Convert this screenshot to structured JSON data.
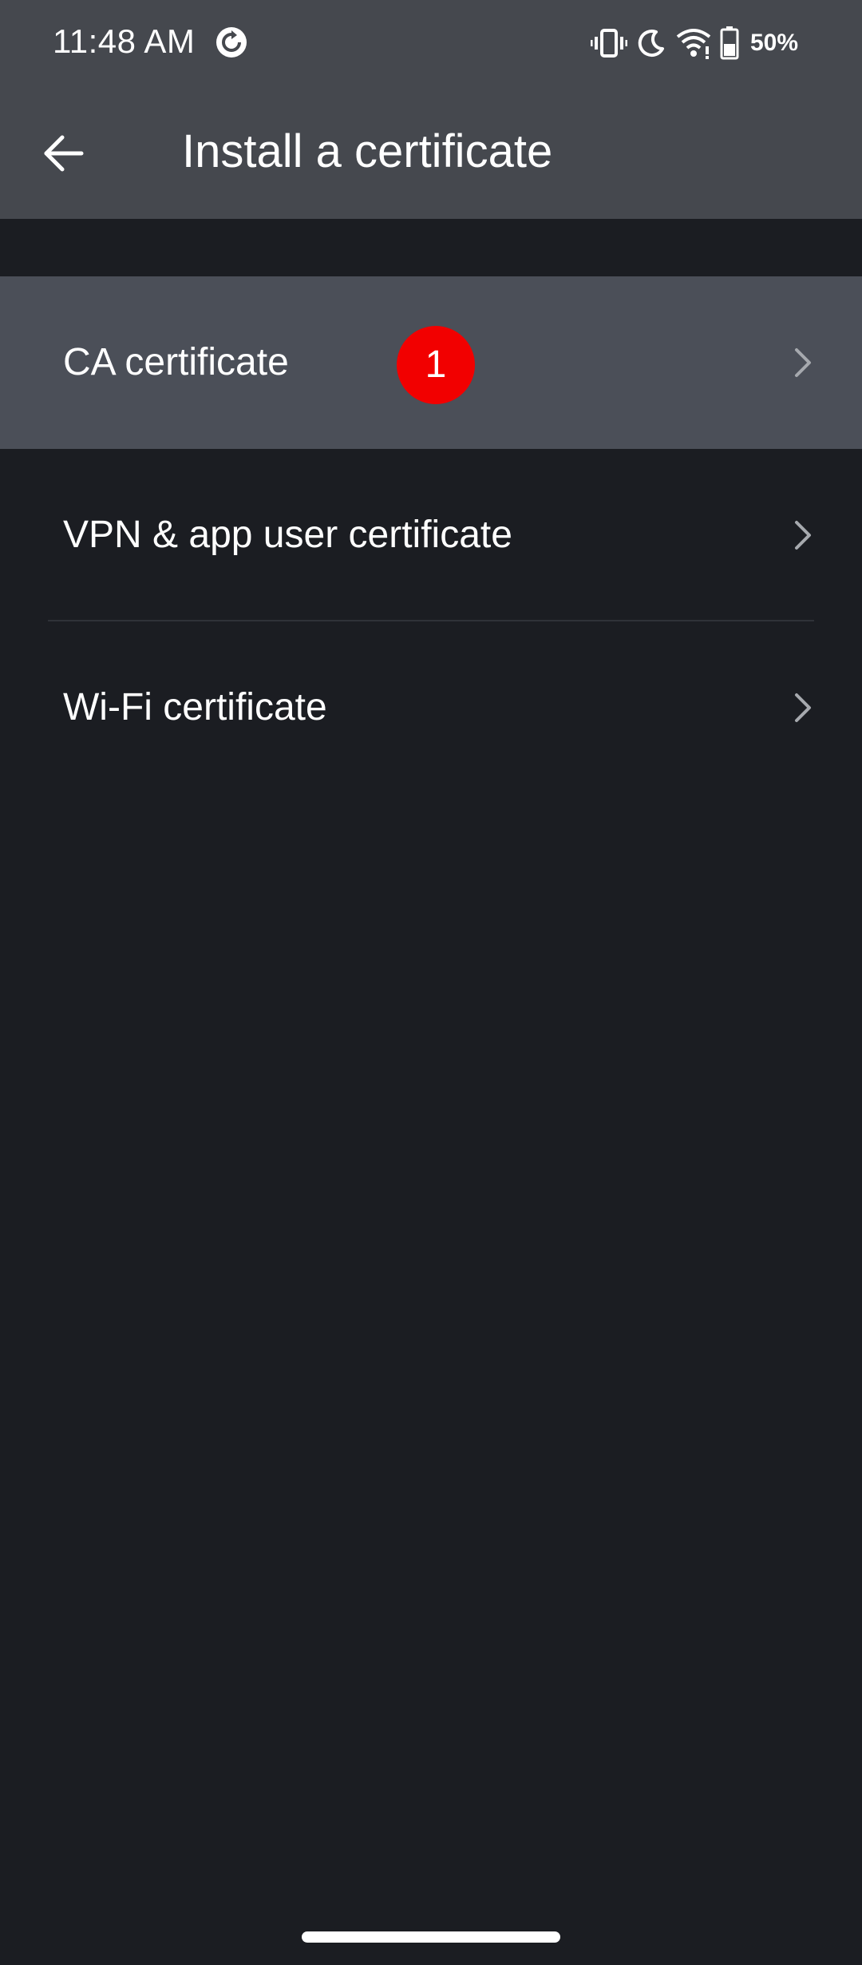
{
  "status_bar": {
    "time": "11:48 AM",
    "sync_icon": "sync-icon",
    "icons": [
      "vibrate-icon",
      "do-not-disturb-icon",
      "wifi-icon",
      "battery-icon"
    ],
    "battery_percent": "50%"
  },
  "app_bar": {
    "back_icon": "arrow-left-icon",
    "title": "Install a certificate"
  },
  "list": {
    "items": [
      {
        "label": "CA certificate",
        "highlighted": true,
        "badge": "1",
        "icon": "chevron-right-icon"
      },
      {
        "label": "VPN & app user certificate",
        "highlighted": false,
        "icon": "chevron-right-icon"
      },
      {
        "label": "Wi-Fi certificate",
        "highlighted": false,
        "icon": "chevron-right-icon"
      }
    ]
  },
  "colors": {
    "app_bar_bg": "#45484e",
    "page_bg": "#1b1d22",
    "highlight_bg": "#4b4f58",
    "badge_bg": "#f20000",
    "text": "#ffffff",
    "chevron": "#a6a9ae"
  }
}
